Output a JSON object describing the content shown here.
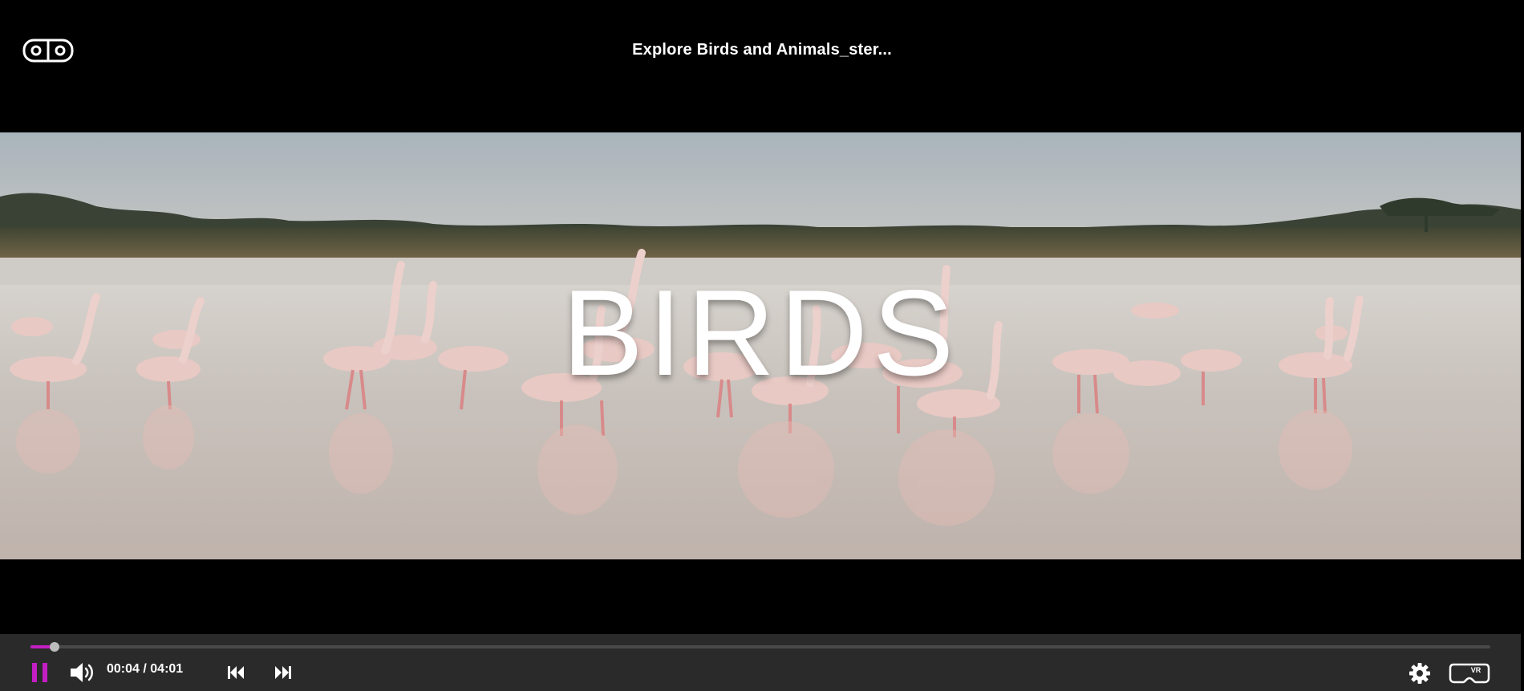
{
  "player": {
    "title": "Explore Birds and Animals_ster...",
    "overlay_text": "BIRDS",
    "progress_fraction": 0.0166,
    "time": {
      "current": "00:04",
      "separator": "/",
      "duration": "04:01"
    },
    "accent_color": "#c21ec2",
    "icons": {
      "top_left": "vr-glasses-icon",
      "play_state": "pause-icon",
      "volume": "volume-icon",
      "previous": "skip-previous-icon",
      "next": "skip-next-icon",
      "settings": "gear-icon",
      "vr_mode": "vr-headset-icon"
    },
    "vr_badge": "VR"
  }
}
